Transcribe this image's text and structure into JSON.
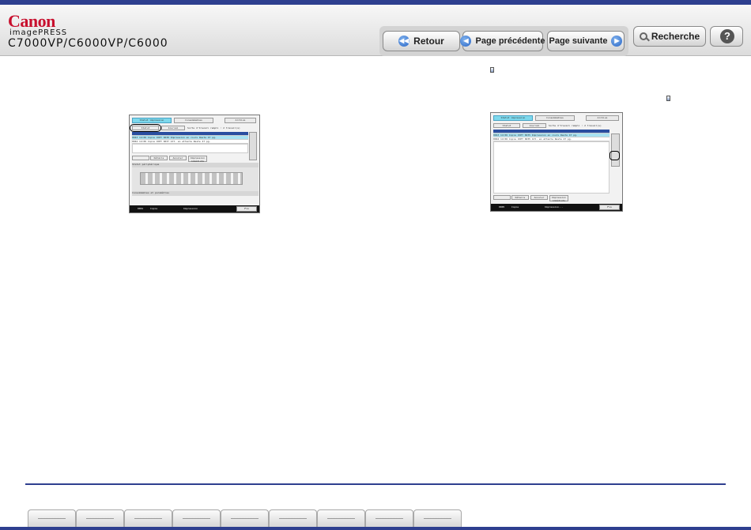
{
  "header": {
    "brand": "Canon",
    "product_line": "imagePRESS",
    "models": "C7000VP/C6000VP/C6000"
  },
  "nav": {
    "back_label": "Retour",
    "prev_label": "Page précédente",
    "next_label": "Page suivante",
    "search_label": "Recherche"
  },
  "screen_left": {
    "tabs": [
      "Statut impression",
      "Consommables",
      "Archive"
    ],
    "buttons": [
      "Statut",
      "Journal"
    ],
    "info": "Sorte d'travail rempli : 2 travail(s)",
    "rows": [
      {
        "no": "0043 14:06",
        "type": "Copie",
        "name": "COPY 6030",
        "status": "Impression en cours",
        "pages": "Reste 47 pg."
      },
      {
        "no": "0042 14:06",
        "type": "Copie",
        "name": "COPY 6037",
        "status": "Att. en attente",
        "pages": "Reste 47 pg."
      }
    ],
    "action_buttons": [
      "Détails",
      "Annuler",
      "Impression immédiate"
    ],
    "section_status": "Statut périphérique",
    "section_consumables": "Consommables et paramètres",
    "footer_job": "0001",
    "footer_mode": "Copie",
    "footer_status": "Impression",
    "footer_fin": "Fin"
  },
  "screen_right": {
    "tabs": [
      "Statut impression",
      "Consommables",
      "Archive"
    ],
    "buttons": [
      "Statut",
      "Journal"
    ],
    "info": "Sorte d'travail rempli : 2 travail(s)",
    "rows": [
      {
        "no": "0043 14:06",
        "type": "Copie",
        "name": "COPY 6035",
        "status": "Impression en cours",
        "pages": "Reste 47 pg."
      },
      {
        "no": "0042 14:06",
        "type": "Copie",
        "name": "COPY 6035",
        "status": "Att. en attente",
        "pages": "Reste 47 pg."
      }
    ],
    "action_buttons": [
      "Détails",
      "Annuler",
      "Impression immédiate"
    ],
    "footer_job": "0005",
    "footer_mode": "Copie",
    "footer_status": "Impression...",
    "footer_fin": "Fin"
  },
  "footer": {
    "tab_count": 9
  }
}
